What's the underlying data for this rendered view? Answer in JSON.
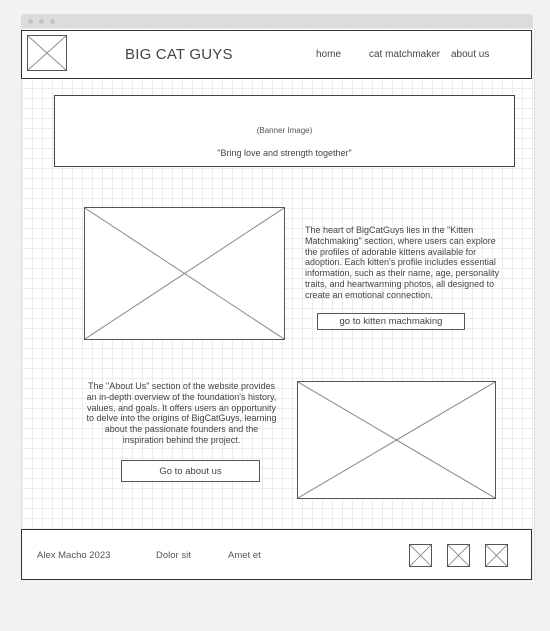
{
  "site": {
    "title": "BIG CAT GUYS"
  },
  "nav": {
    "items": [
      {
        "label": "home"
      },
      {
        "label": "cat matchmaker"
      },
      {
        "label": "about us"
      }
    ]
  },
  "banner": {
    "label": "(Banner Image)",
    "tagline": "\"Bring love and strength together\""
  },
  "matchmaker": {
    "description": "The heart of BigCatGuys lies in the \"Kitten Matchmaking\" section, where users can explore the profiles of adorable kittens available for adoption. Each kitten's profile includes essential information, such as their name, age, personality traits, and heartwarming photos, all designed to create an emotional connection.",
    "button_label": "go to kitten machmaking"
  },
  "about": {
    "description": "The \"About Us\" section of the website provides an in-depth overview of the foundation's history, values, and goals. It offers users an opportunity to delve into the origins of BigCatGuys, learning about the passionate founders and the inspiration behind the project.",
    "button_label": "Go to about us"
  },
  "footer": {
    "copyright": "Alex Macho 2023",
    "link1": "Dolor sit",
    "link2": "Amet et"
  }
}
